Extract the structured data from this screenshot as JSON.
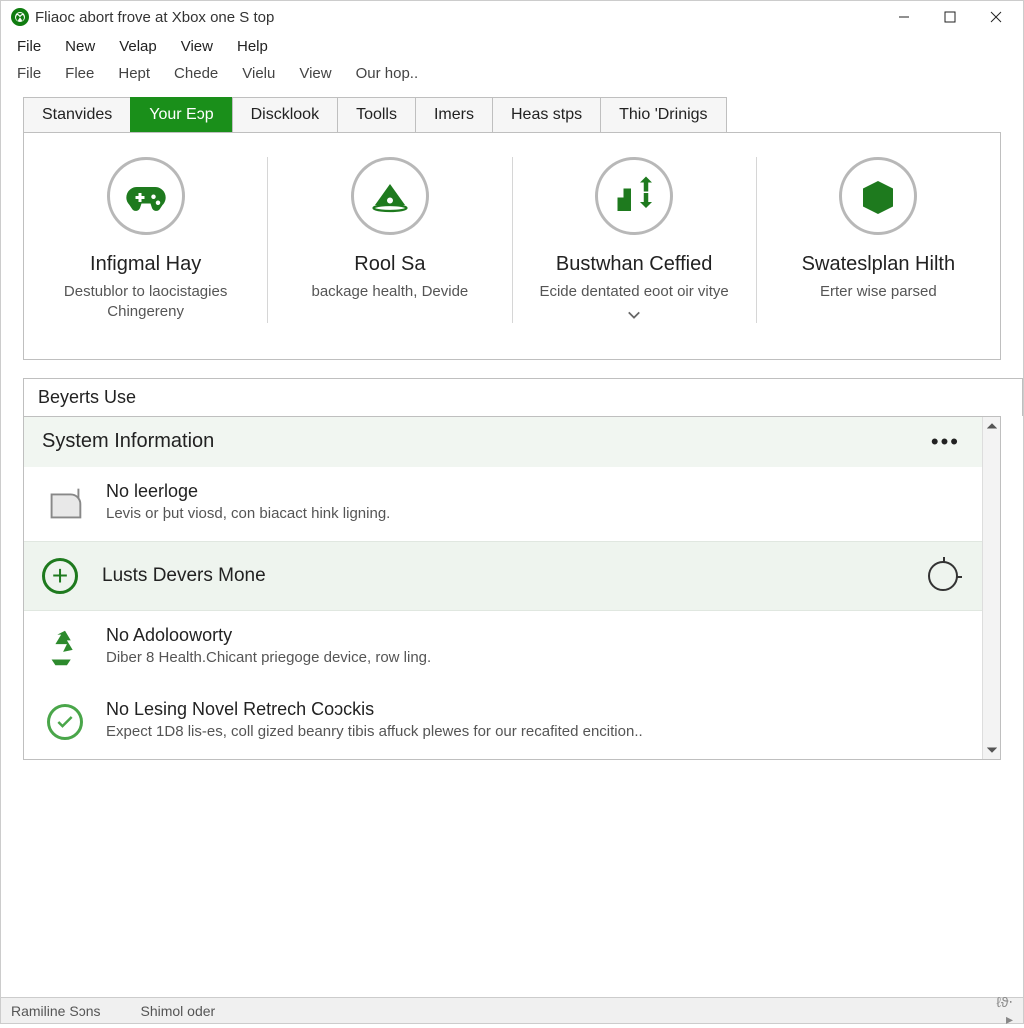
{
  "window": {
    "title": "Fliaoc abort frove at Xbox one S top"
  },
  "menu1": [
    "File",
    "New",
    "Velap",
    "View",
    "Help"
  ],
  "menu2": [
    "File",
    "Flee",
    "Hept",
    "Chede",
    "Vielu",
    "View",
    "Our hop.."
  ],
  "tabs": [
    {
      "label": "Stanvides"
    },
    {
      "label": "Your Eɔp"
    },
    {
      "label": "Discklook"
    },
    {
      "label": "Toolls"
    },
    {
      "label": "Imers"
    },
    {
      "label": "Heas stps"
    },
    {
      "label": "Thio 'Drinigs"
    }
  ],
  "active_tab_index": 1,
  "cards": [
    {
      "title": "Infigmal Hay",
      "desc": "Destublor to laocistagies Chingereny",
      "icon": "gamepad"
    },
    {
      "title": "Rool Sa",
      "desc": "backage health, Devide",
      "icon": "disc"
    },
    {
      "title": "Bustwhan Ceffied",
      "desc": "Ecide dentated eoot oir vitye",
      "icon": "transfer",
      "chevron": true
    },
    {
      "title": "Swateslplan Hilth",
      "desc": "Erter wise parsed",
      "icon": "box"
    }
  ],
  "lower_tab": "Beyerts Use",
  "sysinfo": {
    "heading": "System Information"
  },
  "sys_items": [
    {
      "kind": "info",
      "icon": "mailbox",
      "title": "No leerloge",
      "desc": "Levis or þut viosd, con biacact hink ligning."
    },
    {
      "kind": "expand",
      "title": "Lusts Devers Mone"
    },
    {
      "kind": "info",
      "icon": "recycle",
      "title": "No Adolooworty",
      "desc": "Diber 8 Health.Chicant priegoge device, row ling."
    },
    {
      "kind": "ok",
      "title": "No Lesing Novel Retrech Coɔckis",
      "desc": "Expect 1D8 lis-es, coll gized beanry tibis affuck plewes for our recafited encition.."
    }
  ],
  "status": {
    "left": "Ramiline Sɔns",
    "mid": "Shimol oder",
    "right": "ℓϑ‧▸"
  },
  "colors": {
    "accent": "#1a8f1a"
  }
}
